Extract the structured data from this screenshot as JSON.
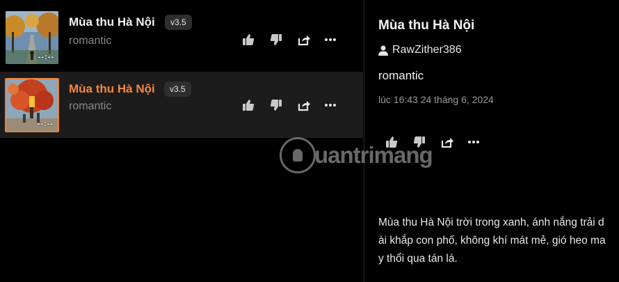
{
  "songs": [
    {
      "title": "Mùa thu Hà Nội",
      "version": "v3.5",
      "style": "romantic",
      "duration": "--:--",
      "active": false
    },
    {
      "title": "Mùa thu Hà Nội",
      "version": "v3.5",
      "style": "romantic",
      "duration": "--:--",
      "active": true
    }
  ],
  "detail": {
    "title": "Mùa thu Hà Nội",
    "user": "RawZither386",
    "style": "romantic",
    "created": "lúc 16:43 24 tháng 6, 2024",
    "lyrics": "Mùa thu Hà Nội trời trong xanh, ánh nắng trải dài khắp con phố, không khí mát mẻ, gió heo may thổi qua tán lá."
  },
  "icons": {
    "like": "thumbs-up-icon",
    "dislike": "thumbs-down-icon",
    "share": "share-icon",
    "more": "more-icon",
    "user": "user-icon"
  },
  "watermark": "uantrimang",
  "colors": {
    "background": "#000000",
    "accent": "#f5883e",
    "selected_row": "#1c1c1c",
    "badge": "#2e2e2e"
  }
}
